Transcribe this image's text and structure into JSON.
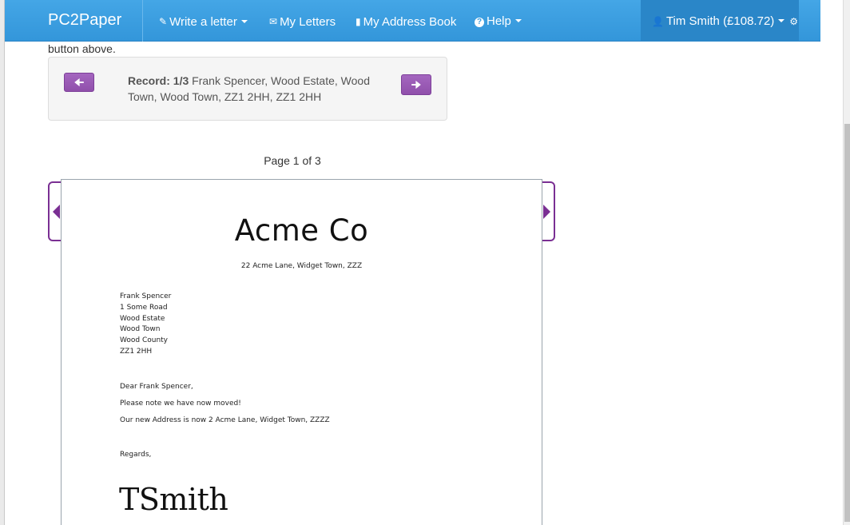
{
  "navbar": {
    "brand": "PC2Paper",
    "items": [
      {
        "icon": "pencil-icon",
        "glyph": "✎",
        "label": "Write a letter",
        "dropdown": true
      },
      {
        "icon": "envelope-icon",
        "glyph": "✉",
        "label": "My Letters",
        "dropdown": false
      },
      {
        "icon": "book-icon",
        "glyph": "▮",
        "label": "My Address Book",
        "dropdown": false
      },
      {
        "icon": "question-icon",
        "glyph": "?",
        "label": "Help",
        "dropdown": true
      }
    ],
    "user": {
      "icon": "user-icon",
      "label": "Tim Smith (£108.72)",
      "settings_icon": "gear-icon"
    }
  },
  "intro_text": "button above.",
  "record": {
    "label": "Record:",
    "position": "1/3",
    "details": "Frank Spencer, Wood Estate, Wood Town, Wood Town, ZZ1 2HH, ZZ1 2HH",
    "prev_icon": "arrow-left-icon",
    "next_icon": "arrow-right-icon"
  },
  "page_indicator": "Page 1 of 3",
  "letter": {
    "company_name": "Acme Co",
    "company_address": "22 Acme Lane, Widget Town, ZZZ",
    "recipient": [
      "Frank Spencer",
      "1 Some Road",
      "Wood Estate",
      "Wood Town",
      "Wood County",
      "ZZ1 2HH"
    ],
    "greeting": "Dear Frank Spencer,",
    "body_1": "Please note we have now moved!",
    "body_2": "Our new Address is now 2 Acme Lane, Widget Town, ZZZZ",
    "closing": "Regards,",
    "signature": "TSmith"
  },
  "colors": {
    "navbar": "#3a9de0",
    "navbar_user": "#2a86c8",
    "accent_purple": "#9b59b6",
    "frame_purple": "#7a2f93"
  }
}
